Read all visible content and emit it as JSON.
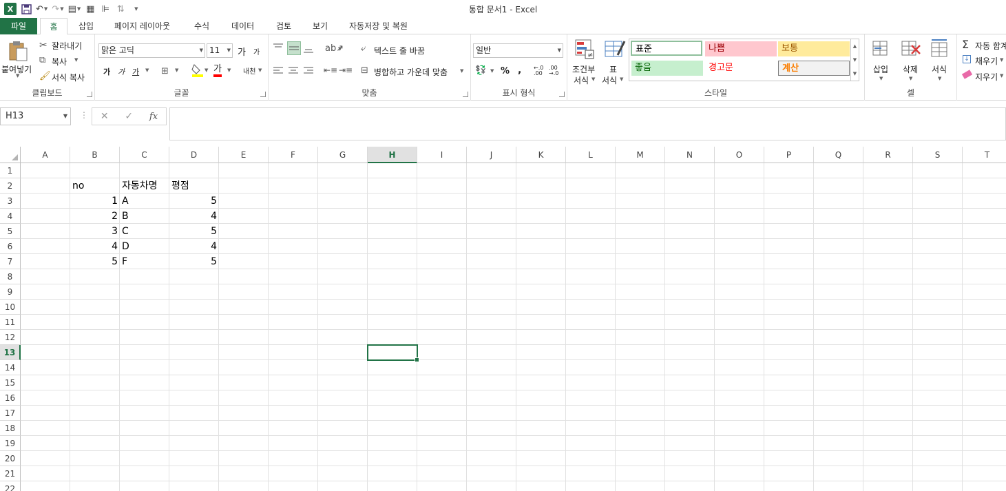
{
  "window": {
    "title": "통합 문서1 - Excel"
  },
  "tabs": [
    {
      "label": "파일"
    },
    {
      "label": "홈"
    },
    {
      "label": "삽입"
    },
    {
      "label": "페이지 레이아웃"
    },
    {
      "label": "수식"
    },
    {
      "label": "데이터"
    },
    {
      "label": "검토"
    },
    {
      "label": "보기"
    },
    {
      "label": "자동저장 및 복원"
    }
  ],
  "ribbon": {
    "clipboard": {
      "paste": "붙여넣기",
      "cut": "잘라내기",
      "copy": "복사",
      "format_painter": "서식 복사",
      "label": "클립보드"
    },
    "font": {
      "name": "맑은 고딕",
      "size": "11",
      "grow": "가",
      "shrink": "가",
      "bold": "가",
      "italic": "가",
      "underline": "가",
      "font_color": "가",
      "phonetic": "내천",
      "label": "글꼴"
    },
    "alignment": {
      "wrap": "텍스트 줄 바꿈",
      "merge": "병합하고 가운데 맞춤",
      "label": "맞춤"
    },
    "number": {
      "format": "일반",
      "percent": "%",
      "comma": ",",
      "inc_decimal": "←.0 .00",
      "dec_decimal": ".00 →.0",
      "label": "표시 형식"
    },
    "styles": {
      "conditional": "조건부\n서식",
      "conditional_l1": "조건부",
      "conditional_l2": "서식",
      "table_l1": "표",
      "table_l2": "서식",
      "cells": [
        {
          "label": "표준",
          "bg": "#ffffff",
          "color": "#000000"
        },
        {
          "label": "나쁨",
          "bg": "#ffc7ce",
          "color": "#9c0006"
        },
        {
          "label": "보통",
          "bg": "#ffeb9c",
          "color": "#9c5700"
        },
        {
          "label": "좋음",
          "bg": "#c6efce",
          "color": "#006100"
        },
        {
          "label": "경고문",
          "bg": "#ffffff",
          "color": "#ff0000"
        },
        {
          "label": "계산",
          "bg": "#f2f2f2",
          "color": "#fa7d00"
        }
      ],
      "label": "스타일"
    },
    "cells": {
      "insert": "삽입",
      "delete": "삭제",
      "format": "서식",
      "label": "셀"
    },
    "editing": {
      "autosum": "자동 합계",
      "fill": "채우기",
      "clear": "지우기"
    }
  },
  "formula_bar": {
    "name_box": "H13",
    "cancel": "✕",
    "enter": "✓",
    "fx": "fx",
    "value": ""
  },
  "sheet": {
    "columns": [
      "A",
      "B",
      "C",
      "D",
      "E",
      "F",
      "G",
      "H",
      "I",
      "J",
      "K",
      "L",
      "M",
      "N",
      "O",
      "P",
      "Q",
      "R",
      "S",
      "T"
    ],
    "rows": [
      "1",
      "2",
      "3",
      "4",
      "5",
      "6",
      "7",
      "8",
      "9",
      "10",
      "11",
      "12",
      "13",
      "14",
      "15",
      "16",
      "17",
      "18",
      "19",
      "20",
      "21",
      "22"
    ],
    "selected_col": "H",
    "selected_row": "13",
    "cells": [
      {
        "col": "B",
        "row": 2,
        "value": "no",
        "align": "left"
      },
      {
        "col": "C",
        "row": 2,
        "value": "자동차명",
        "align": "left"
      },
      {
        "col": "D",
        "row": 2,
        "value": "평점",
        "align": "left"
      },
      {
        "col": "B",
        "row": 3,
        "value": "1",
        "align": "right"
      },
      {
        "col": "C",
        "row": 3,
        "value": "A",
        "align": "left"
      },
      {
        "col": "D",
        "row": 3,
        "value": "5",
        "align": "right"
      },
      {
        "col": "B",
        "row": 4,
        "value": "2",
        "align": "right"
      },
      {
        "col": "C",
        "row": 4,
        "value": "B",
        "align": "left"
      },
      {
        "col": "D",
        "row": 4,
        "value": "4",
        "align": "right"
      },
      {
        "col": "B",
        "row": 5,
        "value": "3",
        "align": "right"
      },
      {
        "col": "C",
        "row": 5,
        "value": "C",
        "align": "left"
      },
      {
        "col": "D",
        "row": 5,
        "value": "5",
        "align": "right"
      },
      {
        "col": "B",
        "row": 6,
        "value": "4",
        "align": "right"
      },
      {
        "col": "C",
        "row": 6,
        "value": "D",
        "align": "left"
      },
      {
        "col": "D",
        "row": 6,
        "value": "4",
        "align": "right"
      },
      {
        "col": "B",
        "row": 7,
        "value": "5",
        "align": "right"
      },
      {
        "col": "C",
        "row": 7,
        "value": "F",
        "align": "left"
      },
      {
        "col": "D",
        "row": 7,
        "value": "5",
        "align": "right"
      }
    ]
  },
  "colors": {
    "accent": "#217346",
    "gridline": "#e1e1e1"
  }
}
